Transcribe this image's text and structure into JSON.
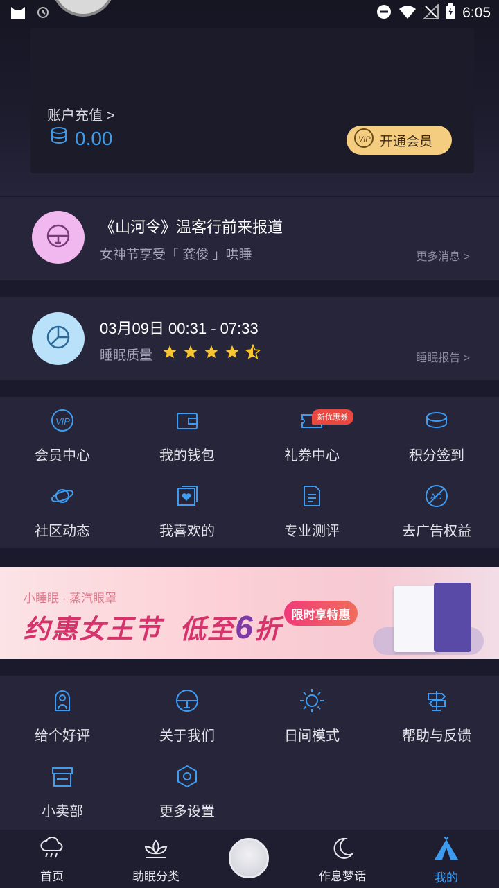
{
  "status_bar": {
    "time": "6:05"
  },
  "account": {
    "recharge_label": "账户充值 >",
    "balance": "0.00",
    "vip_button": "开通会员"
  },
  "news": {
    "title": "《山河令》温客行前来报道",
    "subtitle": "女神节享受「 龚俊 」哄睡",
    "more": "更多消息 >"
  },
  "sleep": {
    "time_range": "03月09日 00:31 - 07:33",
    "quality_label": "睡眠质量",
    "rating": 4.5,
    "rating_max": 5,
    "more": "睡眠报告 >"
  },
  "grid1": [
    {
      "label": "会员中心",
      "icon": "vip-icon"
    },
    {
      "label": "我的钱包",
      "icon": "wallet-icon"
    },
    {
      "label": "礼券中心",
      "icon": "ticket-icon"
    },
    {
      "label": "积分签到",
      "icon": "coin-icon"
    },
    {
      "label": "社区动态",
      "icon": "planet-icon"
    },
    {
      "label": "我喜欢的",
      "icon": "favorite-icon"
    },
    {
      "label": "专业测评",
      "icon": "document-icon"
    },
    {
      "label": "去广告权益",
      "icon": "no-ad-icon"
    }
  ],
  "coupon_badge": "新优惠券",
  "banner": {
    "small": "小睡眠 · 蒸汽眼罩",
    "big_part1": "约惠女王节  低至",
    "big_num": "6",
    "big_part2": "折",
    "cta": "限时享特惠"
  },
  "grid2": [
    {
      "label": "给个好评",
      "icon": "rate-icon"
    },
    {
      "label": "关于我们",
      "icon": "about-icon"
    },
    {
      "label": "日间模式",
      "icon": "sun-icon"
    },
    {
      "label": "帮助与反馈",
      "icon": "signpost-icon"
    },
    {
      "label": "小卖部",
      "icon": "shop-icon"
    },
    {
      "label": "更多设置",
      "icon": "settings-icon"
    }
  ],
  "nav": [
    {
      "label": "首页",
      "icon": "rain-cloud-icon"
    },
    {
      "label": "助眠分类",
      "icon": "lotus-icon"
    },
    {
      "label": "作息梦话",
      "icon": "moon-icon"
    },
    {
      "label": "我的",
      "icon": "tent-icon"
    }
  ],
  "colors": {
    "accent": "#3e9cf0",
    "vip_gold": "#f5cd80",
    "panel": "#262539",
    "background": "#1b1a2c",
    "star": "#f7c531"
  }
}
